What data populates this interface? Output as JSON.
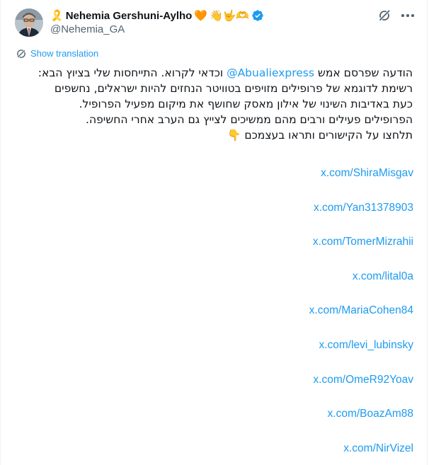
{
  "author": {
    "name": "Nehemia Gershuni-Aylho",
    "handle": "@Nehemia_GA",
    "name_emojis": [
      "🎗️",
      "🧡",
      "👋",
      "🤟",
      "🫶"
    ],
    "verified": true
  },
  "translate_label": "Show translation",
  "tweet": {
    "line1_before": "הודעה שפרסם אמש ",
    "line1_mention": "@Abualiexpress",
    "line1_after": " וכדאי לקרוא. התייחסות שלי בציוץ הבא:",
    "lines": [
      "רשימת לדוגמא של פרופילים מזויפים בטוויטר הנחזים להיות ישראלים, נחשפים",
      "כעת באדיבות השינוי של אילון מאסק שחושף את מיקום מפעיל הפרופיל.",
      "הפרופילים פעילים ורבים מהם ממשיכים לצייץ גם הערב אחרי החשיפה.",
      "תלחצו על הקישורים ותראו בעצמכם 👇"
    ],
    "links": [
      "x.com/ShiraMisgav",
      "x.com/Yan31378903",
      "x.com/TomerMizrahii",
      "x.com/lital0a",
      "x.com/MariaCohen84",
      "x.com/levi_lubinsky",
      "x.com/OmeR92Yoav",
      "x.com/BoazAm88",
      "x.com/NirVizel"
    ]
  },
  "colors": {
    "link": "#1d9bf0",
    "text": "#0f1419",
    "muted": "#536471",
    "verified": "#1d9bf0"
  },
  "icons": [
    "grok-icon",
    "more-icon",
    "translate-icon",
    "verified-badge-icon"
  ]
}
